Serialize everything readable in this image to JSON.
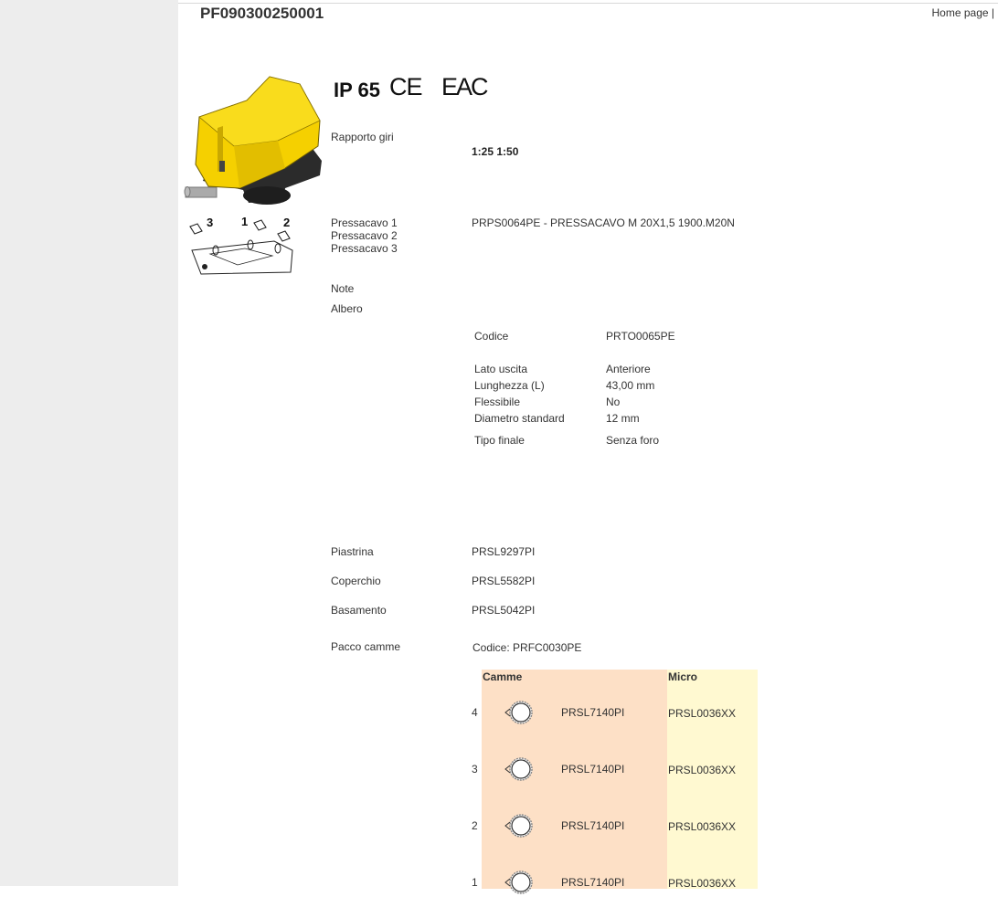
{
  "header": {
    "product_code": "PF090300250001",
    "home_link": "Home page |"
  },
  "certifications": {
    "ip_rating": "IP 65",
    "ce_mark": "CE",
    "eac_mark": "EAC"
  },
  "specs": {
    "rapporto_giri_label": "Rapporto giri",
    "rapporto_giri_value": "1:25 1:50",
    "pressacavo_1_label": "Pressacavo 1",
    "pressacavo_2_label": "Pressacavo 2",
    "pressacavo_3_label": "Pressacavo 3",
    "pressacavo_value": "PRPS0064PE - PRESSACAVO M 20X1,5 1900.M20N",
    "note_label": "Note",
    "albero_label": "Albero"
  },
  "albero": [
    {
      "key": "Codice",
      "value": "PRTO0065PE"
    },
    {
      "key": "Lato uscita",
      "value": "Anteriore"
    },
    {
      "key": "Lunghezza (L)",
      "value": "43,00 mm"
    },
    {
      "key": "Flessibile",
      "value": "No"
    },
    {
      "key": "Diametro standard",
      "value": "12 mm"
    },
    {
      "key": "Tipo finale",
      "value": "Senza foro"
    }
  ],
  "components": {
    "piastrina_label": "Piastrina",
    "piastrina_value": "PRSL9297PI",
    "coperchio_label": "Coperchio",
    "coperchio_value": "PRSL5582PI",
    "basamento_label": "Basamento",
    "basamento_value": "PRSL5042PI",
    "pacco_camme_label": "Pacco camme",
    "pacco_camme_value": "Codice: PRFC0030PE"
  },
  "cam_table": {
    "camme_header": "Camme",
    "micro_header": "Micro",
    "rows": [
      {
        "num": "4",
        "cam": "PRSL7140PI",
        "micro": "PRSL0036XX"
      },
      {
        "num": "3",
        "cam": "PRSL7140PI",
        "micro": "PRSL0036XX"
      },
      {
        "num": "2",
        "cam": "PRSL7140PI",
        "micro": "PRSL0036XX"
      },
      {
        "num": "1",
        "cam": "PRSL7140PI",
        "micro": "PRSL0036XX"
      }
    ]
  },
  "diagram_labels": {
    "n3": "3",
    "n1": "1",
    "n2": "2"
  },
  "colors": {
    "camme_bg": "#fde0c6",
    "micro_bg": "#fff9d1",
    "product_yellow": "#f5d000",
    "gutter": "#ededed"
  }
}
